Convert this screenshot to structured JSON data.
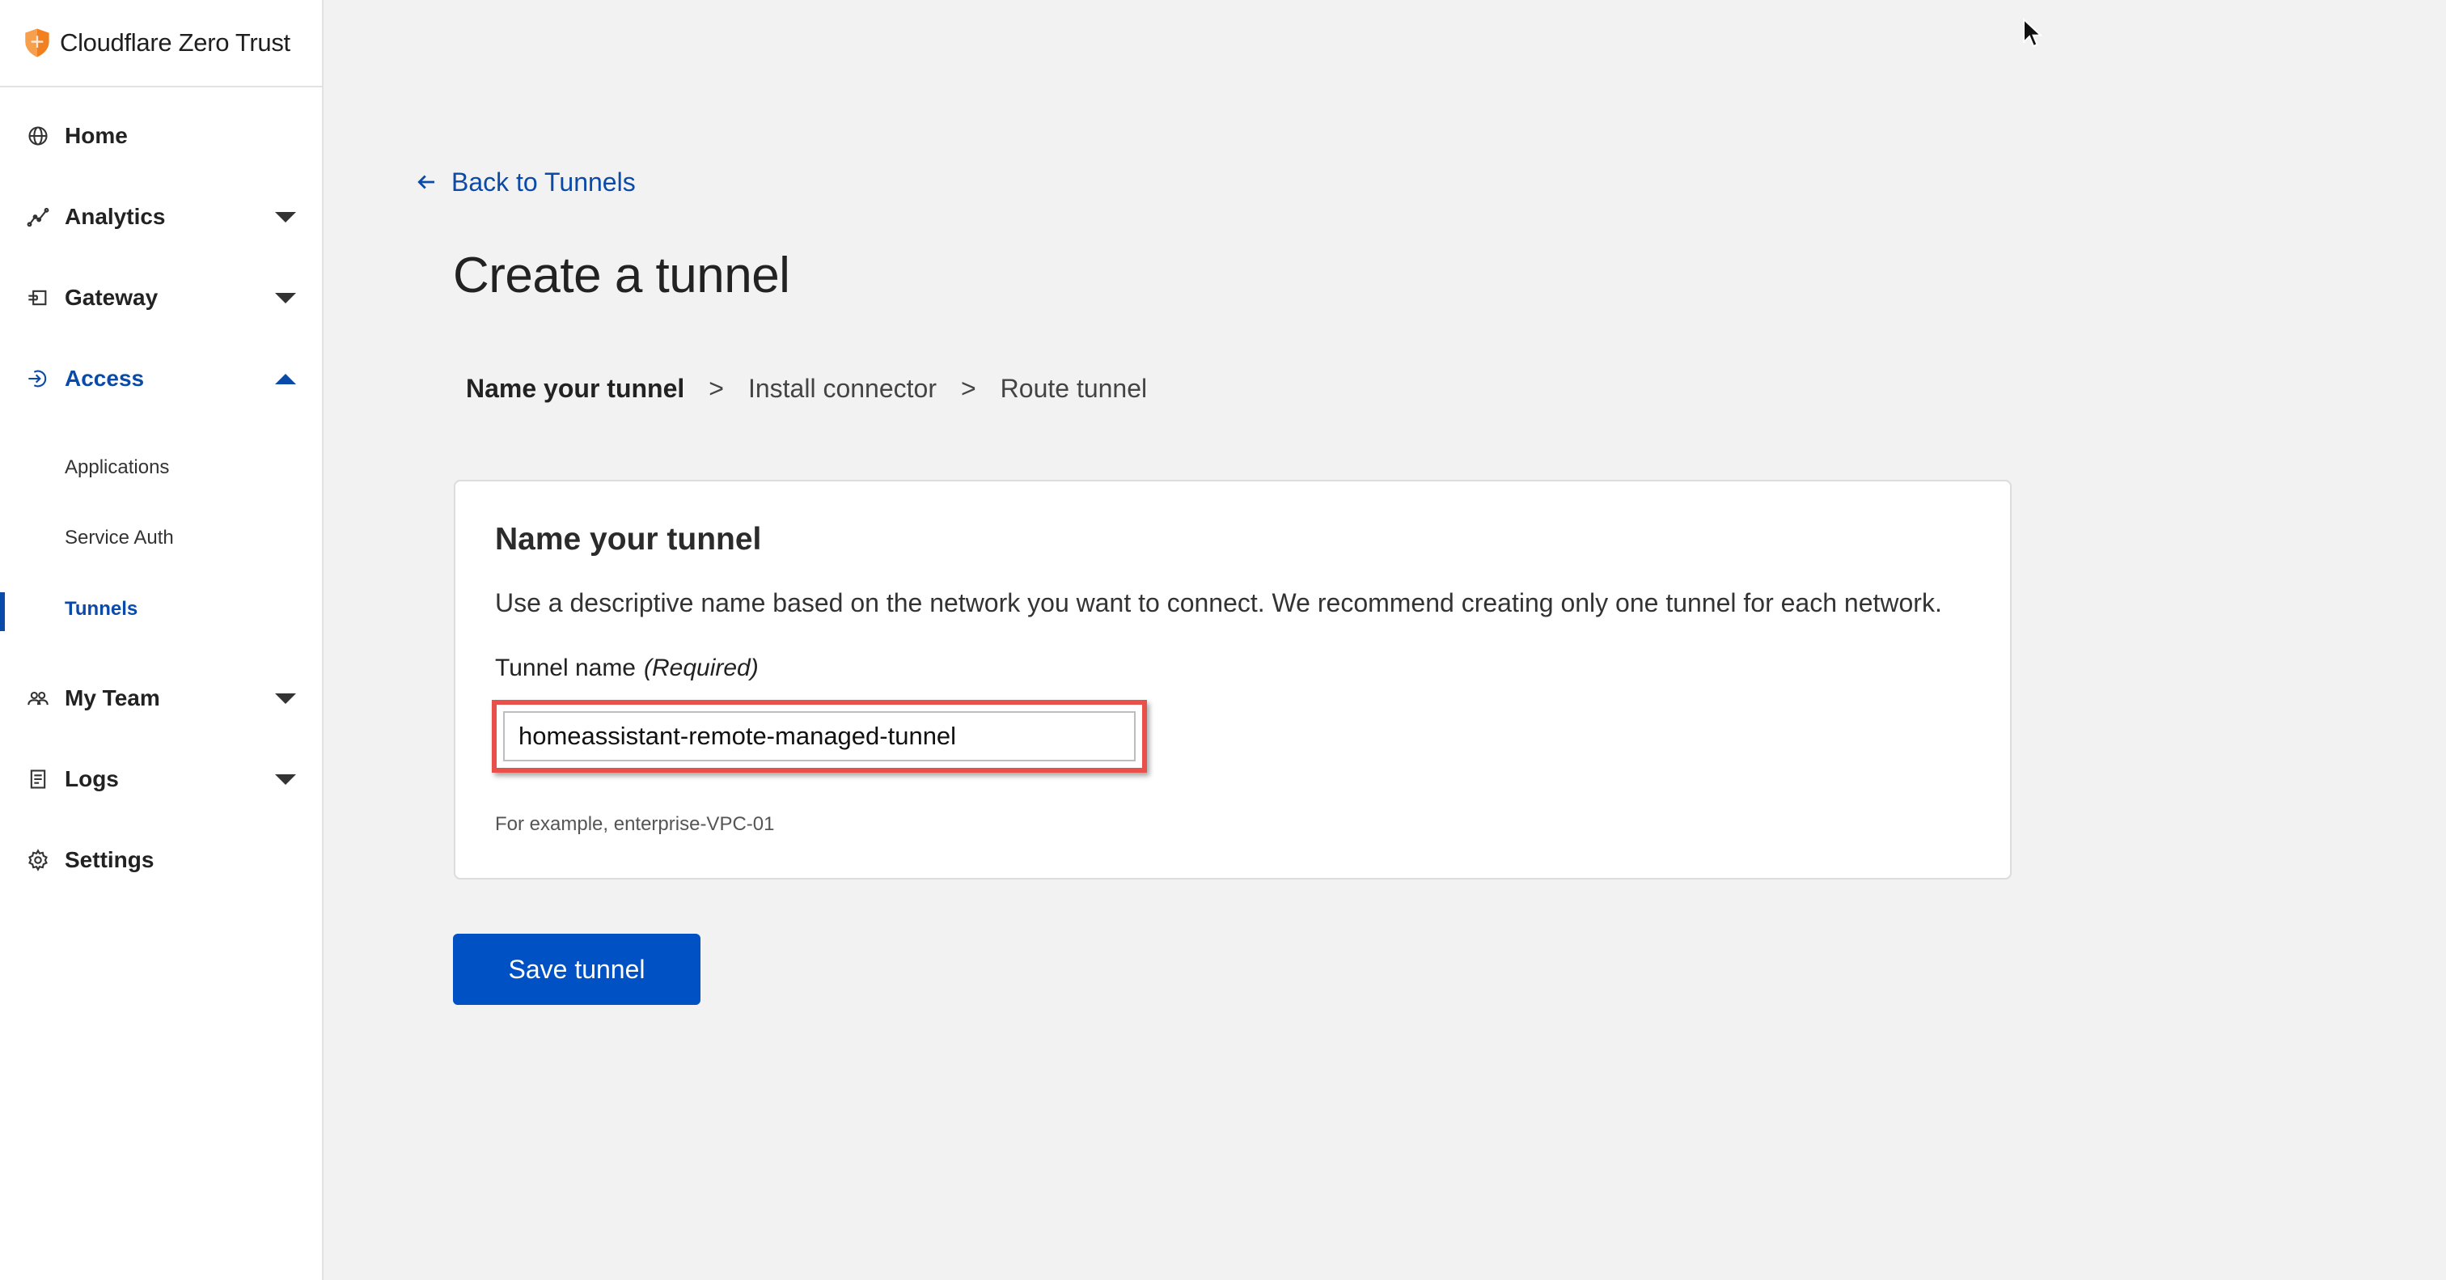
{
  "app": {
    "title": "Cloudflare Zero Trust"
  },
  "colors": {
    "accent": "#0a4aa8",
    "button": "#0051c3",
    "highlight": "#e8514a",
    "brand_orange": "#f38020"
  },
  "sidebar": {
    "items": [
      {
        "label": "Home",
        "icon": "globe-icon"
      },
      {
        "label": "Analytics",
        "icon": "chart-line-icon",
        "expandable": true
      },
      {
        "label": "Gateway",
        "icon": "gateway-icon",
        "expandable": true
      },
      {
        "label": "Access",
        "icon": "access-icon",
        "expandable": true,
        "expanded": true,
        "active": true
      },
      {
        "label": "My Team",
        "icon": "users-icon",
        "expandable": true
      },
      {
        "label": "Logs",
        "icon": "logs-icon",
        "expandable": true
      },
      {
        "label": "Settings",
        "icon": "gear-icon"
      }
    ],
    "access_subitems": [
      {
        "label": "Applications"
      },
      {
        "label": "Service Auth"
      },
      {
        "label": "Tunnels",
        "active": true
      }
    ]
  },
  "main": {
    "back_link": "Back to Tunnels",
    "page_title": "Create a tunnel",
    "steps": [
      {
        "label": "Name your tunnel",
        "current": true
      },
      {
        "label": "Install connector"
      },
      {
        "label": "Route tunnel"
      }
    ],
    "step_separator": ">",
    "card": {
      "title": "Name your tunnel",
      "description": "Use a descriptive name based on the network you want to connect. We recommend creating only one tunnel for each network.",
      "field_label": "Tunnel name",
      "field_required": "(Required)",
      "input_value": "homeassistant-remote-managed-tunnel",
      "hint": "For example, enterprise-VPC-01"
    },
    "save_button": "Save tunnel"
  }
}
